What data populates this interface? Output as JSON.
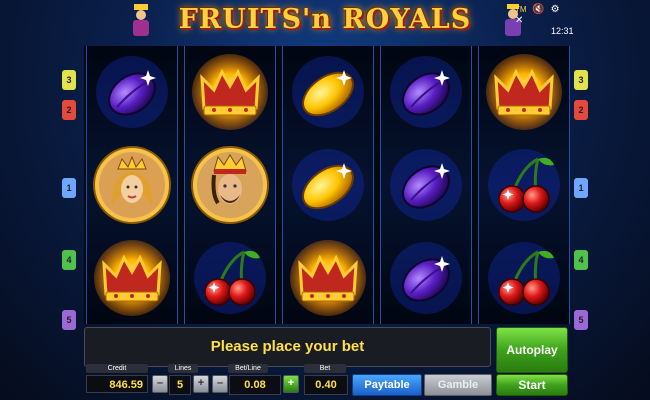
{
  "game": {
    "title": "FRUITS'n ROYALS",
    "tm": "TM",
    "clock": "12:31"
  },
  "system_icons": [
    "sound-icon",
    "options-icon",
    "close-icon"
  ],
  "reels": [
    [
      "plum",
      "woman",
      "crown"
    ],
    [
      "crown",
      "king",
      "cherry"
    ],
    [
      "lemon",
      "lemon",
      "crown"
    ],
    [
      "plum",
      "plum",
      "plum"
    ],
    [
      "crown",
      "cherry",
      "cherry"
    ]
  ],
  "line_indicators": {
    "left": [
      {
        "label": "3",
        "color": "#e1e24c"
      },
      {
        "label": "2",
        "color": "#e34a3b"
      },
      {
        "label": "1",
        "color": "#6fa7ff"
      },
      {
        "label": "4",
        "color": "#4ec24e"
      },
      {
        "label": "5",
        "color": "#9b68d6"
      }
    ],
    "right": [
      {
        "label": "3",
        "color": "#e1e24c"
      },
      {
        "label": "2",
        "color": "#e34a3b"
      },
      {
        "label": "1",
        "color": "#6fa7ff"
      },
      {
        "label": "4",
        "color": "#4ec24e"
      },
      {
        "label": "5",
        "color": "#9b68d6"
      }
    ]
  },
  "message": "Please place your bet",
  "controls": {
    "credit_label": "Credit",
    "credit_value": "846.59",
    "lines_label": "Lines",
    "lines_value": "5",
    "betline_label": "Bet/Line",
    "betline_value": "0.08",
    "bet_label": "Bet",
    "bet_value": "0.40",
    "minus": "–",
    "plus": "+",
    "paytable": "Paytable",
    "gamble": "Gamble",
    "autoplay": "Autoplay",
    "start": "Start"
  },
  "colors": {
    "accent_yellow": "#ffe04a",
    "start_green": "#3ea21c",
    "paytable_blue": "#1b5fc9"
  }
}
